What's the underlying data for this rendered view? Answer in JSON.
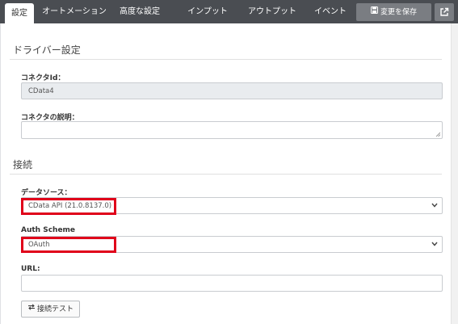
{
  "nav": {
    "tabs": [
      {
        "label": "設定",
        "active": true
      },
      {
        "label": "オートメーション",
        "active": false
      },
      {
        "label": "高度な設定",
        "active": false
      },
      {
        "label": "インプット",
        "active": false
      },
      {
        "label": "アウトプット",
        "active": false
      },
      {
        "label": "イベント",
        "active": false
      }
    ],
    "save_label": "変更を保存",
    "save_icon": "save-icon",
    "external_icon": "external-link-icon"
  },
  "driver_section": {
    "title": "ドライバー設定",
    "connector_id": {
      "label": "コネクタId：",
      "value": "CData4"
    },
    "connector_desc": {
      "label": "コネクタの説明：",
      "value": ""
    }
  },
  "connection_section": {
    "title": "接続",
    "data_source": {
      "label": "データソース：",
      "value": "CData API (21.0.8137.0)"
    },
    "auth_scheme": {
      "label": "Auth Scheme",
      "value": "OAuth"
    },
    "url": {
      "label": "URL:",
      "value": ""
    },
    "test_button": {
      "label": "接続テスト",
      "icon": "swap-arrows-icon"
    }
  },
  "colors": {
    "nav_bg": "#4a4d52",
    "button_bg": "#7a7d82",
    "highlight": "#e0001a"
  }
}
